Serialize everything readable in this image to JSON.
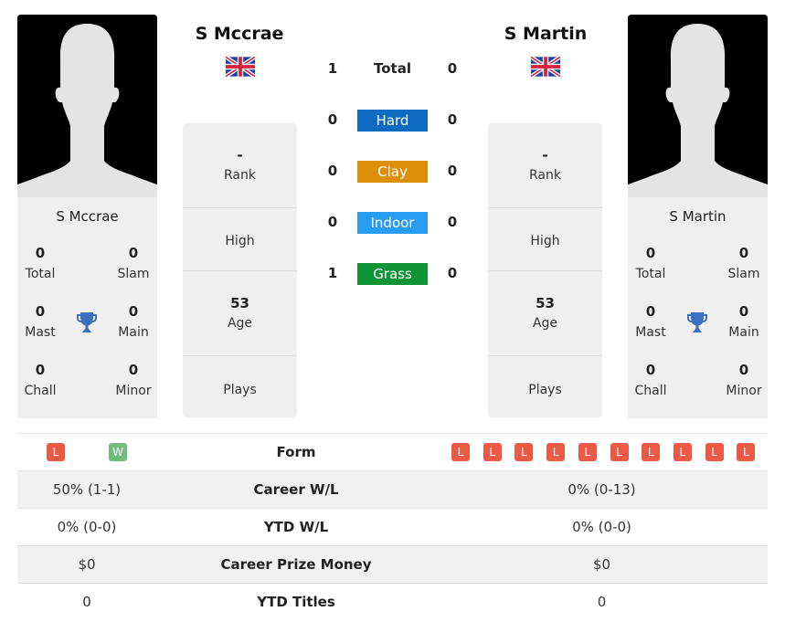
{
  "players": {
    "left": {
      "name": "S Mccrae",
      "flag": "uk-flag",
      "titles": {
        "total": "0",
        "slam": "0",
        "mast": "0",
        "main": "0",
        "chall": "0",
        "minor": "0"
      },
      "rank": "-",
      "high": "",
      "age": "53",
      "plays": "",
      "form": [
        "L",
        "W"
      ]
    },
    "right": {
      "name": "S Martin",
      "flag": "uk-flag",
      "titles": {
        "total": "0",
        "slam": "0",
        "mast": "0",
        "main": "0",
        "chall": "0",
        "minor": "0"
      },
      "rank": "-",
      "high": "",
      "age": "53",
      "plays": "",
      "form": [
        "L",
        "L",
        "L",
        "L",
        "L",
        "L",
        "L",
        "L",
        "L",
        "L"
      ]
    }
  },
  "title_labels": {
    "total": "Total",
    "slam": "Slam",
    "mast": "Mast",
    "main": "Main",
    "chall": "Chall",
    "minor": "Minor"
  },
  "info_labels": {
    "rank": "Rank",
    "high": "High",
    "age": "Age",
    "plays": "Plays"
  },
  "h2h": {
    "total": {
      "label": "Total",
      "left": "1",
      "right": "0"
    },
    "surfaces": [
      {
        "label": "Hard",
        "left": "0",
        "right": "0",
        "color": "#0c6bc0"
      },
      {
        "label": "Clay",
        "left": "0",
        "right": "0",
        "color": "#de8f0a"
      },
      {
        "label": "Indoor",
        "left": "0",
        "right": "0",
        "color": "#2a9cf0"
      },
      {
        "label": "Grass",
        "left": "1",
        "right": "0",
        "color": "#0f9538"
      }
    ]
  },
  "comparison": {
    "form_label": "Form",
    "rows": [
      {
        "label": "Career W/L",
        "left": "50% (1-1)",
        "right": "0% (0-13)"
      },
      {
        "label": "YTD W/L",
        "left": "0% (0-0)",
        "right": "0% (0-0)"
      },
      {
        "label": "Career Prize Money",
        "left": "$0",
        "right": "$0"
      },
      {
        "label": "YTD Titles",
        "left": "0",
        "right": "0"
      }
    ]
  },
  "colors": {
    "loss": "#ea5a47",
    "win": "#71bd7b",
    "trophy": "#3b6fc0"
  }
}
